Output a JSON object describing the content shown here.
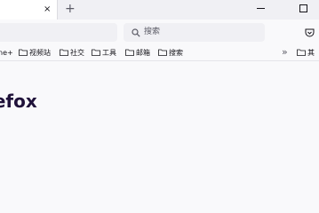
{
  "tabs": {
    "close_glyph": "×",
    "new_tab_glyph": "+"
  },
  "search": {
    "placeholder": "搜索"
  },
  "bookmarks": {
    "items": [
      {
        "label": "ne+",
        "icon": "none"
      },
      {
        "label": "视频站",
        "icon": "folder-icon"
      },
      {
        "label": "社交",
        "icon": "folder-icon"
      },
      {
        "label": "工具",
        "icon": "folder-icon"
      },
      {
        "label": "邮箱",
        "icon": "folder-icon"
      },
      {
        "label": "搜索",
        "icon": "folder-icon"
      }
    ],
    "overflow_glyph": "»",
    "other_label": "其"
  },
  "content": {
    "brand_text": "refox"
  },
  "colors": {
    "toolbar_bg": "#f9f9fb",
    "tabstrip_bg": "#f0f0f4",
    "field_bg": "#f0f0f4",
    "brand_text": "#20123a"
  }
}
